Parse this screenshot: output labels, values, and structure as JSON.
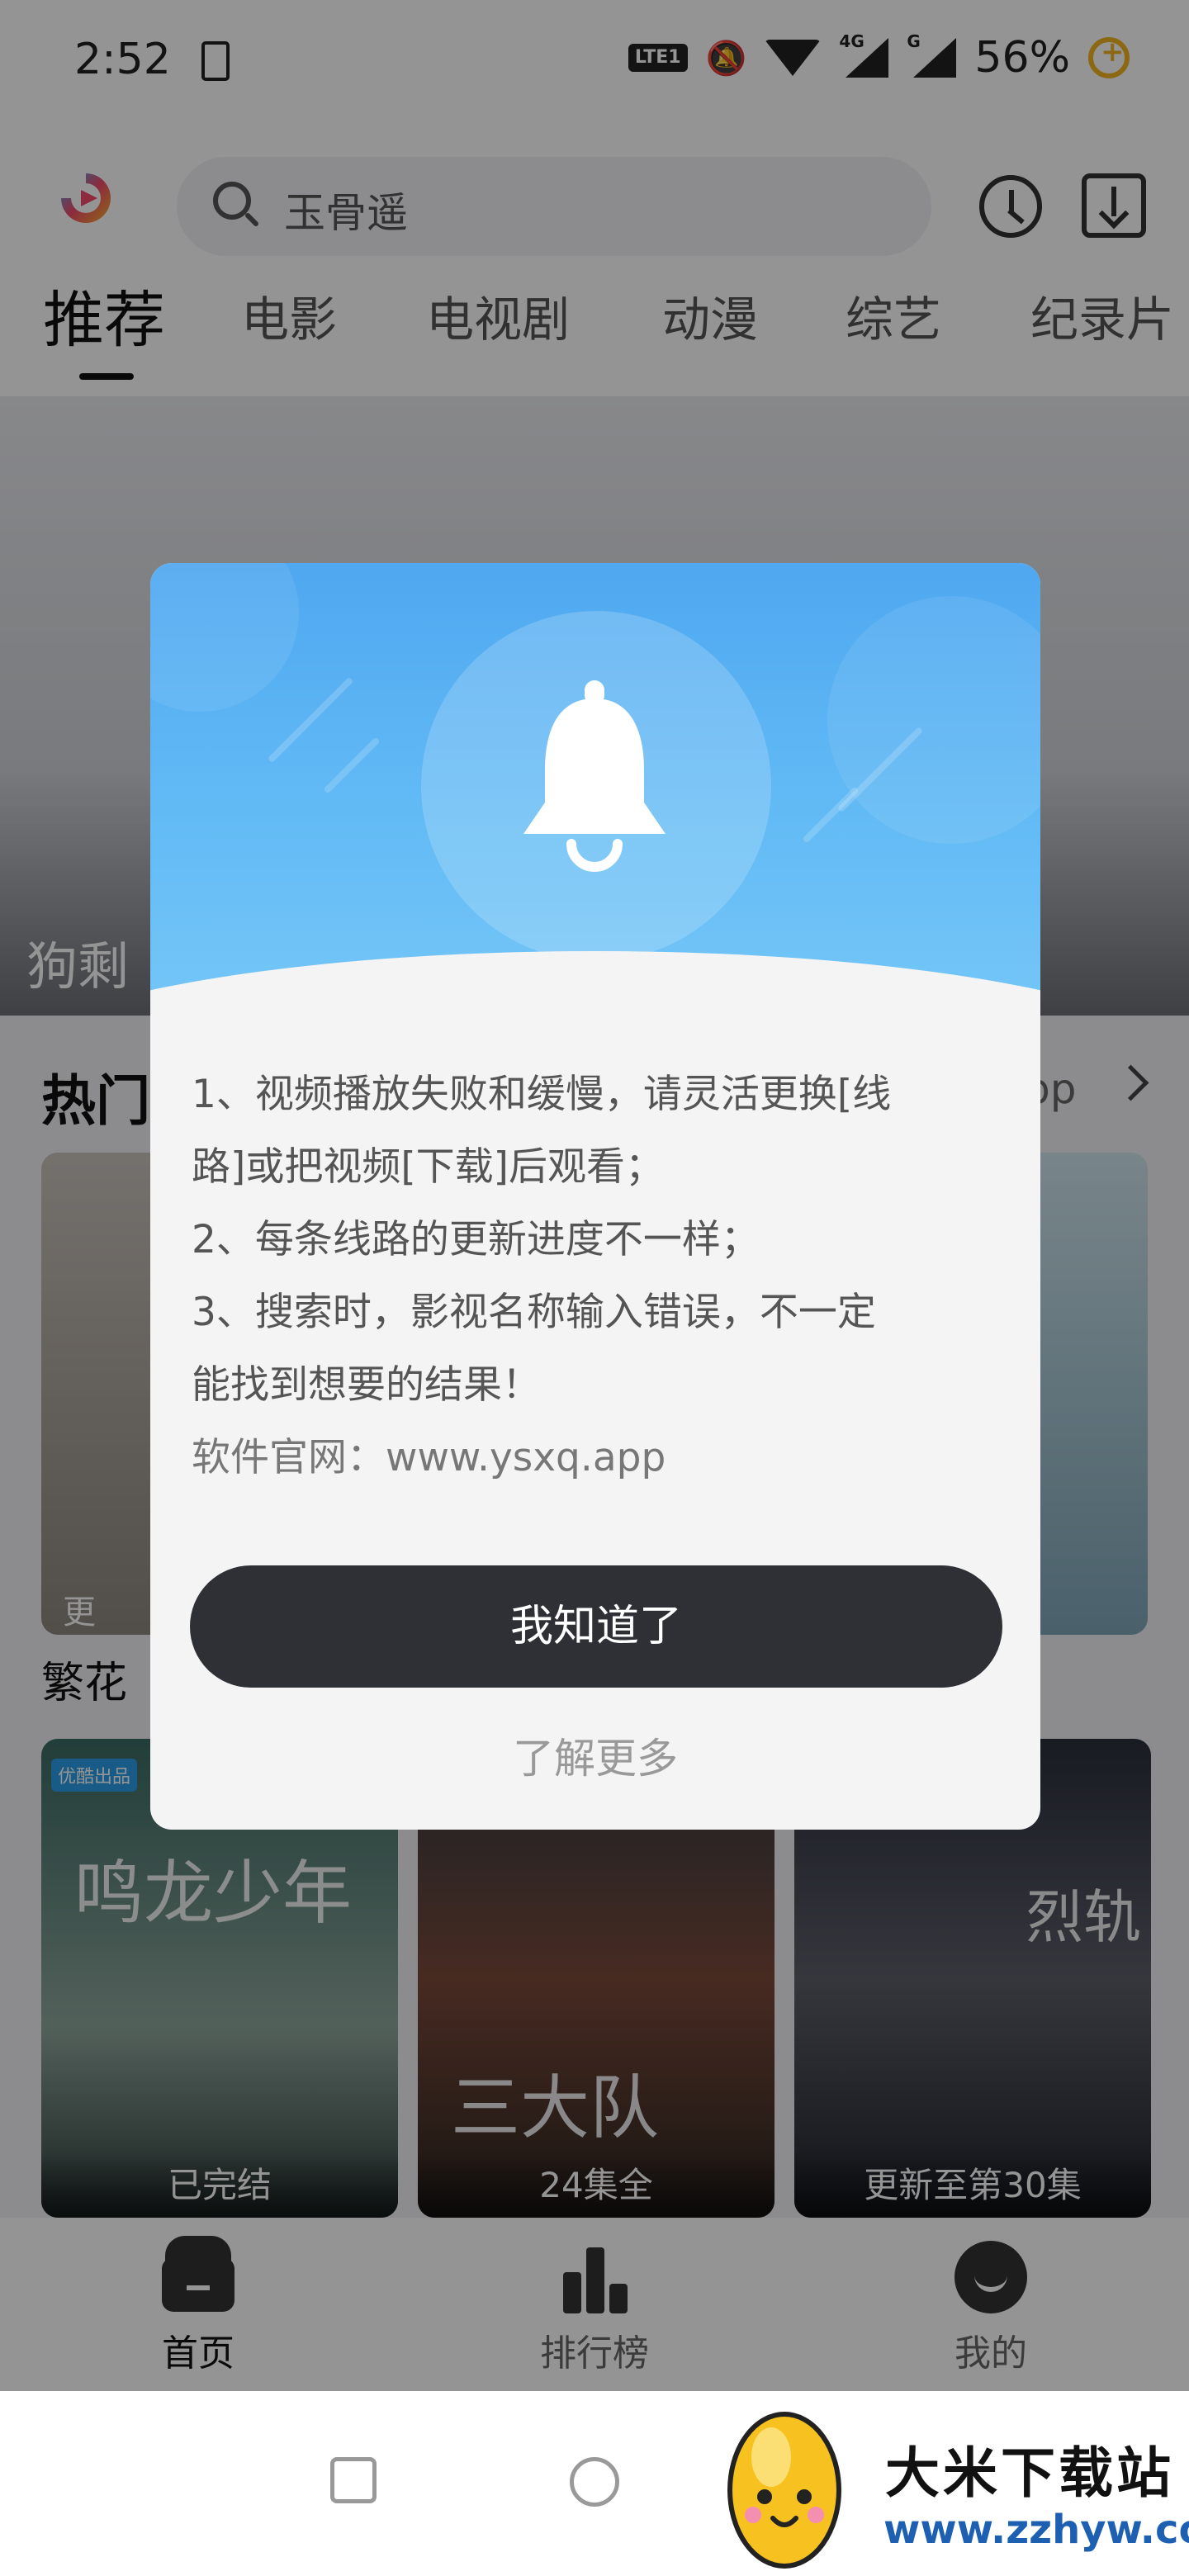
{
  "status_bar": {
    "time": "2:52",
    "network_lte": "LTE1",
    "network_4g": "4G",
    "network_g": "G",
    "battery": "56%"
  },
  "search": {
    "placeholder": "玉骨遥"
  },
  "tabs": [
    {
      "label": "推荐",
      "active": true
    },
    {
      "label": "电影"
    },
    {
      "label": "电视剧"
    },
    {
      "label": "动漫"
    },
    {
      "label": "综艺"
    },
    {
      "label": "纪录片"
    }
  ],
  "banner": {
    "caption": "狗剩"
  },
  "hot_section": {
    "title": "热门",
    "more": "pp",
    "first_status": "更",
    "first_title": "繁花",
    "posters": [
      {
        "badge": "优酷出品",
        "art": "鸣龙少年",
        "caption": "已完结"
      },
      {
        "art": "三大队",
        "caption": "24集全"
      },
      {
        "art": "烈轨",
        "caption": "更新至第30集"
      }
    ]
  },
  "bottom_nav": [
    {
      "label": "首页",
      "icon": "home-icon",
      "active": true
    },
    {
      "label": "排行榜",
      "icon": "ranking-icon"
    },
    {
      "label": "我的",
      "icon": "profile-icon"
    }
  ],
  "dialog": {
    "lines": [
      "1、视频播放失败和缓慢，请灵活更换[线",
      "路]或把视频[下载]后观看；",
      "2、每条线路的更新进度不一样；",
      "3、搜索时，影视名称输入错误，不一定",
      "能找到想要的结果！"
    ],
    "site": "软件官网：www.ysxq.app",
    "confirm": "我知道了",
    "learn_more": "了解更多"
  },
  "watermark": {
    "title": "大米下载站",
    "url": "www.zzhyw.com"
  },
  "colors": {
    "dialog_header": "#5bb3f3",
    "confirm_button": "#2f3036",
    "accent": "#f3b321"
  }
}
